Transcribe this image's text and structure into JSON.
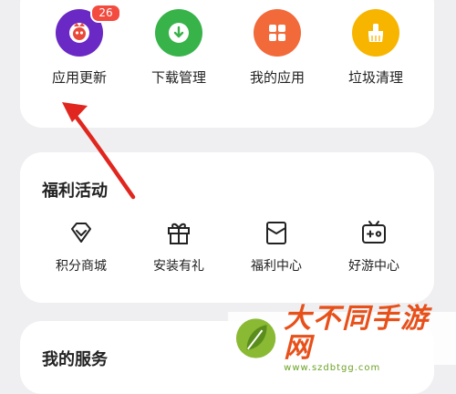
{
  "top_actions": [
    {
      "label": "应用更新",
      "icon": "app-update-icon",
      "color": "#6a28c4",
      "badge": "26"
    },
    {
      "label": "下载管理",
      "icon": "download-icon",
      "color": "#37b34a"
    },
    {
      "label": "我的应用",
      "icon": "my-apps-icon",
      "color": "#f2693a"
    },
    {
      "label": "垃圾清理",
      "icon": "broom-icon",
      "color": "#f7b500"
    }
  ],
  "welfare": {
    "title": "福利活动",
    "items": [
      {
        "label": "积分商城",
        "icon": "diamond-icon"
      },
      {
        "label": "安装有礼",
        "icon": "gift-icon"
      },
      {
        "label": "福利中心",
        "icon": "envelope-icon"
      },
      {
        "label": "好游中心",
        "icon": "tv-game-icon"
      }
    ]
  },
  "service": {
    "title": "我的服务"
  },
  "watermark": {
    "title": "大不同手游网",
    "url": "www.szdbtgg.com"
  }
}
